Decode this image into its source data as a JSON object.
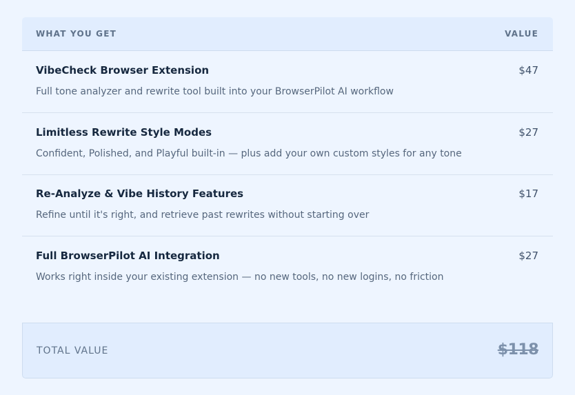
{
  "header": {
    "left_label": "WHAT YOU GET",
    "right_label": "VALUE"
  },
  "items": [
    {
      "title": "VibeCheck Browser Extension",
      "description": "Full tone analyzer and rewrite tool built into your BrowserPilot AI workflow",
      "value": "$47"
    },
    {
      "title": "Limitless Rewrite Style Modes",
      "description": "Confident, Polished, and Playful built-in — plus add your own custom styles for any tone",
      "value": "$27"
    },
    {
      "title": "Re-Analyze & Vibe History Features",
      "description": "Refine until it's right, and retrieve past rewrites without starting over",
      "value": "$17"
    },
    {
      "title": "Full BrowserPilot AI Integration",
      "description": "Works right inside your existing extension — no new tools, no new logins, no friction",
      "value": "$27"
    }
  ],
  "total": {
    "label": "TOTAL VALUE",
    "value": "$118"
  },
  "colors": {
    "page_background": "#eef5ff",
    "header_background": "#e1edfe",
    "title_text": "#16283f",
    "muted_text": "#56677d",
    "strikethrough_value": "#7d91ab"
  }
}
